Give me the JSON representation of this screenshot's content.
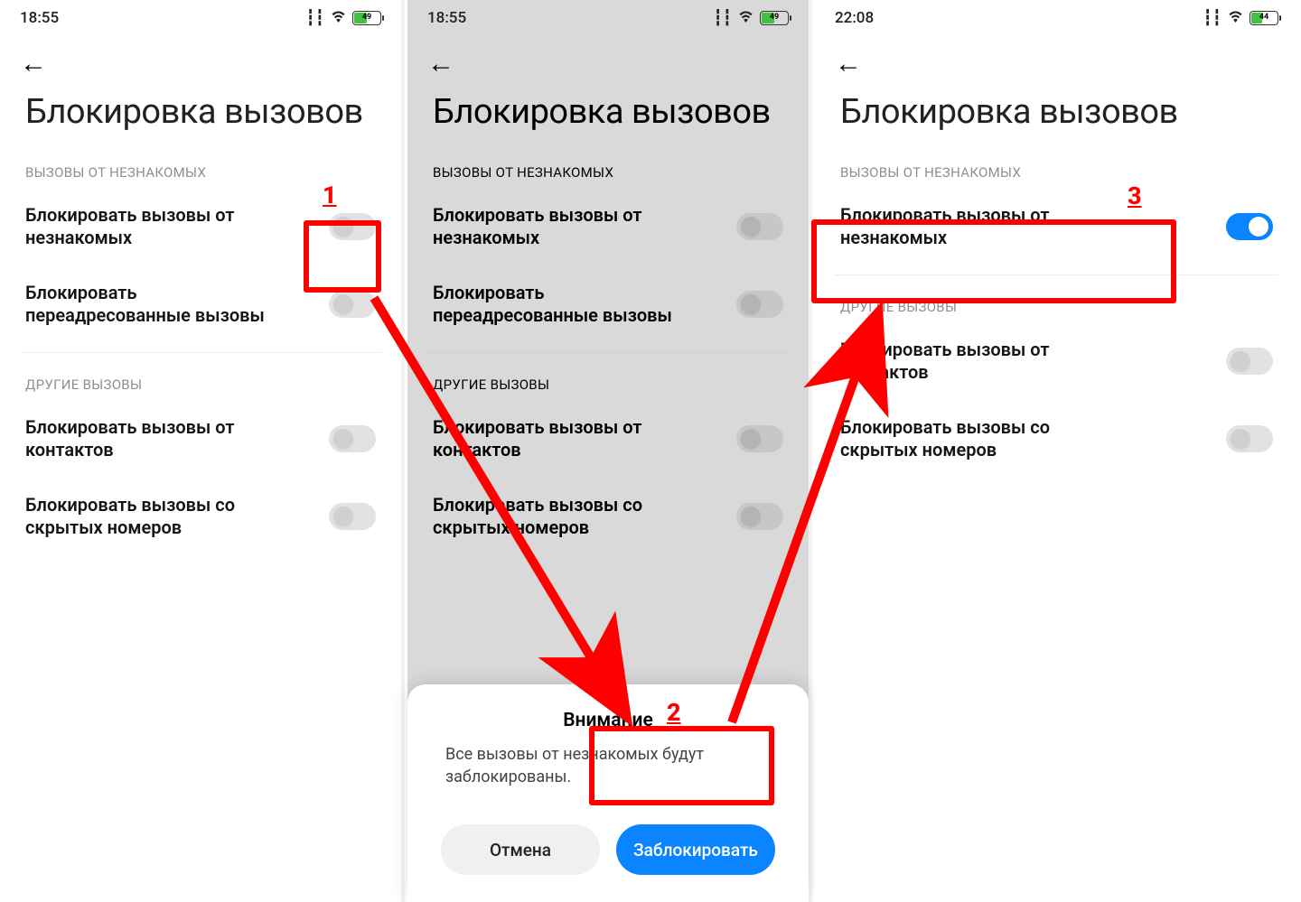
{
  "annotations": {
    "num1": "1",
    "num2": "2",
    "num3": "3"
  },
  "screen1": {
    "status_time": "18:55",
    "battery_pct": "49",
    "battery_fill_pct": 50,
    "title": "Блокировка вызовов",
    "section_a": "ВЫЗОВЫ ОТ НЕЗНАКОМЫХ",
    "row1": "Блокировать вызовы от незнакомых",
    "row2": "Блокировать переадресованные вызовы",
    "section_b": "ДРУГИЕ ВЫЗОВЫ",
    "row3": "Блокировать вызовы от контактов",
    "row4": "Блокировать вызовы со скрытых номеров"
  },
  "screen2": {
    "status_time": "18:55",
    "battery_pct": "49",
    "battery_fill_pct": 50,
    "title": "Блокировка вызовов",
    "section_a": "ВЫЗОВЫ ОТ НЕЗНАКОМЫХ",
    "row1": "Блокировать вызовы от незнакомых",
    "row2": "Блокировать переадресованные вызовы",
    "section_b": "ДРУГИЕ ВЫЗОВЫ",
    "row3": "Блокировать вызовы от контактов",
    "row4": "Блокировать вызовы со скрытых номеров",
    "dialog_title": "Внимание",
    "dialog_body": "Все вызовы от незнакомых будут заблокированы.",
    "cancel": "Отмена",
    "confirm": "Заблокировать"
  },
  "screen3": {
    "status_time": "22:08",
    "battery_pct": "44",
    "battery_fill_pct": 44,
    "title": "Блокировка вызовов",
    "section_a": "ВЫЗОВЫ ОТ НЕЗНАКОМЫХ",
    "row1": "Блокировать вызовы от незнакомых",
    "section_b": "ДРУГИЕ ВЫЗОВЫ",
    "row3": "Блокировать вызовы от контактов",
    "row4": "Блокировать вызовы со скрытых номеров"
  }
}
